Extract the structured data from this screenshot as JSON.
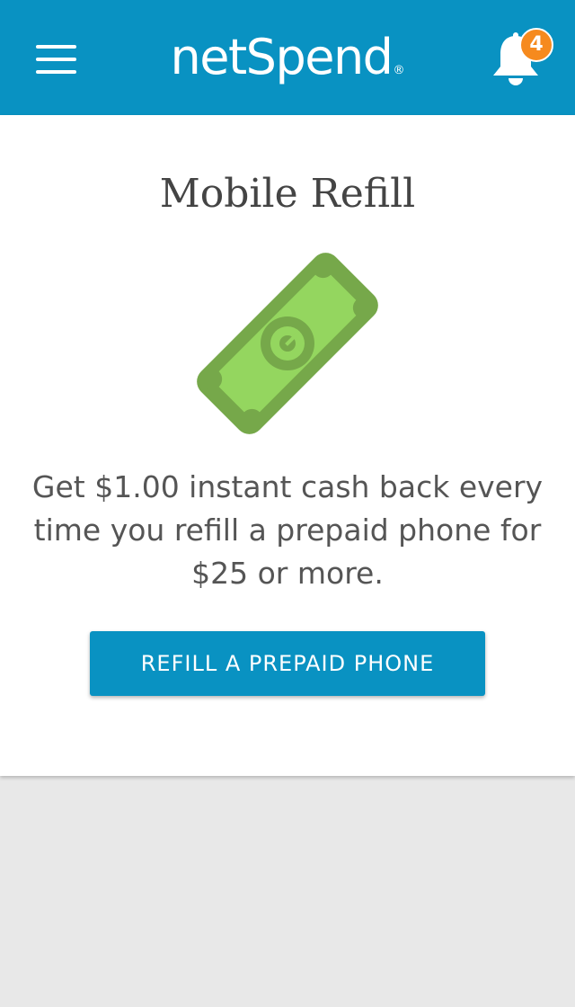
{
  "header": {
    "logo_text": "netSpend",
    "logo_mark": "®",
    "notification_count": "4",
    "background_color": "#0992c2",
    "badge_color": "#f68a1e",
    "menu_icon": "hamburger-menu-icon",
    "bell_icon": "bell-icon"
  },
  "main": {
    "title": "Mobile Refill",
    "illustration_icon": "dollar-bill-icon",
    "description": "Get $1.00 instant cash back every time you refill a prepaid phone for $25 or more.",
    "button_label": "REFILL A PREPAID PHONE",
    "button_color": "#0992c2"
  }
}
